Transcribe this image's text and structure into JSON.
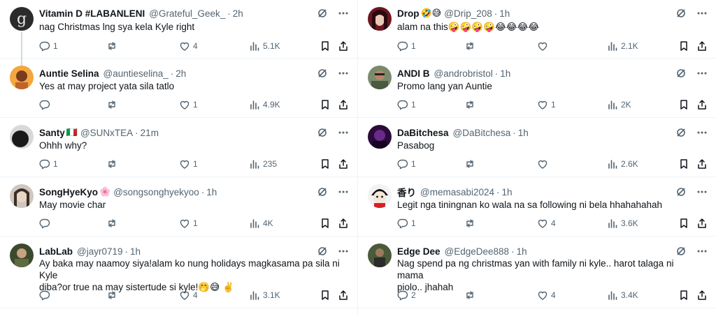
{
  "left": [
    {
      "name": "Vitamin D #LABANLENI",
      "emoji": "",
      "handle": "@Grateful_Geek_",
      "time": "2h",
      "text": [
        "nag Christmas lng sya kela Kyle right"
      ],
      "replies": "1",
      "reposts": "",
      "likes": "4",
      "views": "5.1K"
    },
    {
      "name": "Auntie Selina",
      "emoji": "",
      "handle": "@auntieselina_",
      "time": "2h",
      "text": [
        "Yes at may project yata sila tatlo"
      ],
      "replies": "",
      "reposts": "",
      "likes": "1",
      "views": "4.9K"
    },
    {
      "name": "Santy",
      "emoji": "🇮🇹",
      "handle": "@SUNxTEA",
      "time": "21m",
      "text": [
        "Ohhh why?"
      ],
      "replies": "1",
      "reposts": "",
      "likes": "1",
      "views": "235"
    },
    {
      "name": "SongHyeKyo",
      "emoji": "🌸",
      "handle": "@songsonghyekyoo",
      "time": "1h",
      "text": [
        "May movie char"
      ],
      "replies": "",
      "reposts": "",
      "likes": "1",
      "views": "4K"
    },
    {
      "name": "LabLab",
      "emoji": "",
      "handle": "@jayr0719",
      "time": "1h",
      "text": [
        "Ay baka may naamoy siya!alam ko nung holidays magkasama pa sila ni Kyle",
        "diba?or true na may sistertude si kyle!🤭😅 ✌️"
      ],
      "replies": "",
      "reposts": "",
      "likes": "4",
      "views": "3.1K"
    }
  ],
  "right": [
    {
      "name": "Drop",
      "emoji": "🤣😅",
      "handle": "@Drip_208",
      "time": "1h",
      "text": [
        "alam na this🤪🤪🤪🤪😂😂😂😂"
      ],
      "replies": "1",
      "reposts": "",
      "likes": "",
      "views": "2.1K"
    },
    {
      "name": "ANDI B",
      "emoji": "",
      "handle": "@androbristol",
      "time": "1h",
      "text": [
        "Promo lang yan Auntie"
      ],
      "replies": "1",
      "reposts": "",
      "likes": "1",
      "views": "2K"
    },
    {
      "name": "DaBitchesa",
      "emoji": "",
      "handle": "@DaBitchesa",
      "time": "1h",
      "text": [
        "Pasabog"
      ],
      "replies": "1",
      "reposts": "",
      "likes": "",
      "views": "2.6K"
    },
    {
      "name": "香り",
      "emoji": "",
      "handle": "@memasabi2024",
      "time": "1h",
      "text": [
        "Legit nga tiningnan ko wala na sa following ni bela hhahahahah"
      ],
      "replies": "1",
      "reposts": "",
      "likes": "4",
      "views": "3.6K"
    },
    {
      "name": "Edge Dee",
      "emoji": "",
      "handle": "@EdgeDee888",
      "time": "1h",
      "text": [
        "Nag spend pa ng christmas yan with family ni kyle.. harot talaga ni mama",
        "piolo.. jhahah"
      ],
      "replies": "2",
      "reposts": "",
      "likes": "4",
      "views": "3.4K"
    }
  ]
}
